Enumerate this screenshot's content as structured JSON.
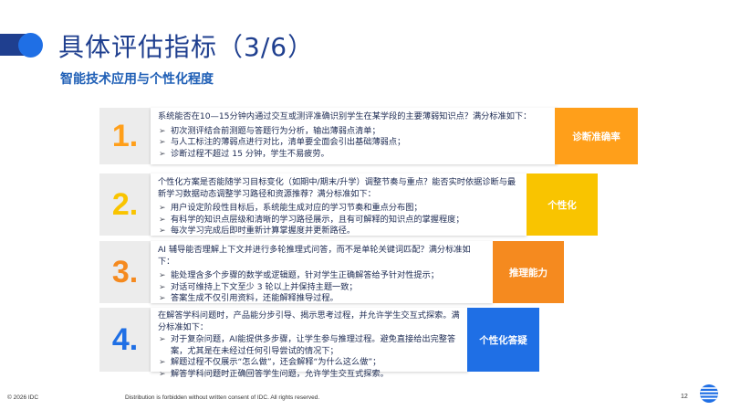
{
  "header": {
    "title": "具体评估指标（3/6）",
    "subtitle": "智能技术应用与个性化程度"
  },
  "colors": {
    "title": "#1f3f8f",
    "accent_blue": "#1f6fe5",
    "card1": "#ff9f1a",
    "card2": "#f9c400",
    "card3": "#f58a1f",
    "card4": "#1f6fe5"
  },
  "cards": [
    {
      "number": "1.",
      "question": "系统能否在10—15分钟内通过交互或测评准确识别学生在某学段的主要薄弱知识点？满分标准如下：",
      "criteria": [
        "初次测评结合前测题与答题行为分析，输出薄弱点清单；",
        "与人工标注的薄弱点进行对比，清单要全面会引出基础薄弱点；",
        "诊断过程不超过 15 分钟，学生不易疲劳。"
      ],
      "tag": "诊断准确率",
      "icon": "arrow-bullet-icon"
    },
    {
      "number": "2.",
      "question": "个性化方案是否能随学习目标变化（如期中/期末/升学）调整节奏与重点？能否实时依据诊断与最新学习数据动态调整学习路径和资源推荐？满分标准如下：",
      "criteria": [
        "用户设定阶段性目标后，系统能生成对应的学习节奏和重点分布图；",
        "有科学的知识点层级和清晰的学习路径展示，且有可解释的知识点的掌握程度；",
        "每次学习完成后即时重新计算掌握度并更新路径。"
      ],
      "tag": "个性化",
      "icon": "arrow-bullet-icon"
    },
    {
      "number": "3.",
      "question": "AI 辅导能否理解上下文并进行多轮推理式问答，而不是单轮关键词匹配？满分标准如下：",
      "criteria": [
        "能处理含多个步骤的数学或逻辑题，针对学生正确解答给予针对性提示；",
        "对话可维持上下文至少 3 轮以上并保持主题一致；",
        "答案生成不仅引用资料，还能解释推导过程。"
      ],
      "tag": "推理能力",
      "icon": "arrow-bullet-icon"
    },
    {
      "number": "4.",
      "question": "在解答学科问题时，产品能分步引导、揭示思考过程，并允许学生交互式探索。满分标准如下：",
      "criteria": [
        "对于复杂问题，AI能提供多步骤，让学生参与推理过程。避免直接给出完整答案，尤其是在未经过任何引导尝试的情况下；",
        "解题过程不仅展示“怎么做”，还会解释“为什么这么做”；",
        "解答学科问题时正确回答学生问题，允许学生交互式探索。"
      ],
      "tag": "个性化答疑",
      "icon": "arrow-bullet-icon"
    }
  ],
  "footer": {
    "copyright": "© 2026 IDC",
    "notice": "Distribution is forbidden without written consent of IDC. All rights reserved.",
    "page_number": "12",
    "logo": "idc-globe-logo"
  }
}
